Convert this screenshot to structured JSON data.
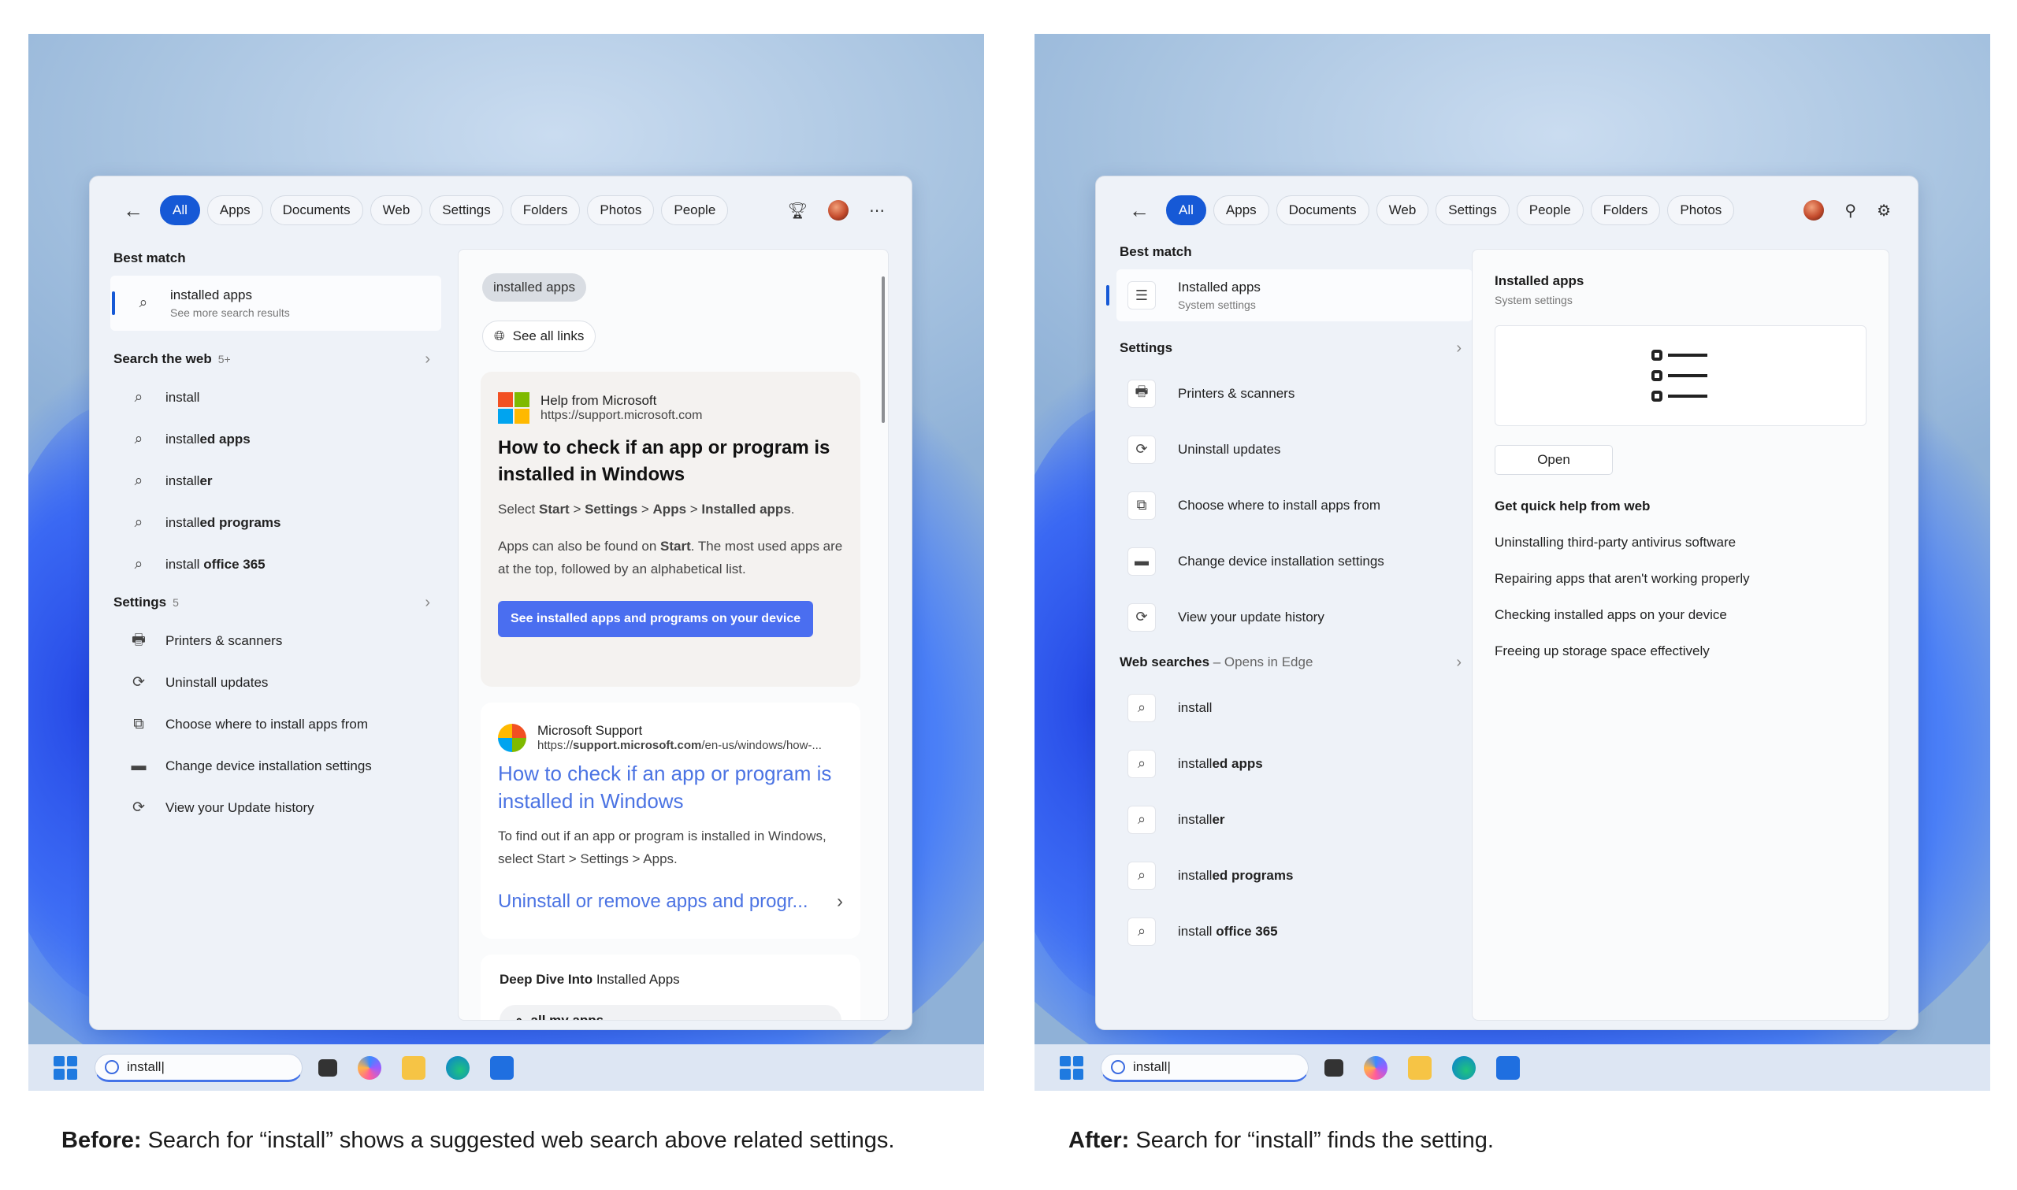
{
  "before": {
    "tabs": [
      "All",
      "Apps",
      "Documents",
      "Web",
      "Settings",
      "Folders",
      "Photos",
      "People"
    ],
    "best_match_label": "Best match",
    "best_match": {
      "title": "installed apps",
      "subtitle": "See more search results"
    },
    "web_section": {
      "label": "Search the web",
      "count": "5+"
    },
    "web_items": [
      {
        "pre": "install",
        "post": ""
      },
      {
        "pre": "install",
        "post": "ed apps"
      },
      {
        "pre": "install",
        "post": "er"
      },
      {
        "pre": "install",
        "post": "ed programs"
      },
      {
        "pre": "install ",
        "post": "office 365"
      }
    ],
    "settings_section": {
      "label": "Settings",
      "count": "5"
    },
    "settings_items": [
      {
        "icon": "printer-icon",
        "glyph": "🖶",
        "label": "Printers & scanners"
      },
      {
        "icon": "refresh-icon",
        "glyph": "⟳",
        "label": "Uninstall updates"
      },
      {
        "icon": "app-install-icon",
        "glyph": "⧉",
        "label": "Choose where to install apps from"
      },
      {
        "icon": "device-bar-icon",
        "glyph": "▬",
        "label": "Change device installation settings"
      },
      {
        "icon": "refresh-icon",
        "glyph": "⟳",
        "label": "View your Update history"
      }
    ],
    "preview": {
      "pill": "installed apps",
      "see_all": "See all links",
      "help_source": "Help from Microsoft",
      "help_url": "https://support.microsoft.com",
      "help_title": "How to check if an app or program is installed in Windows",
      "help_p1_pre": "Select ",
      "help_p1_b1": "Start",
      "help_p1_s1": " > ",
      "help_p1_b2": "Settings",
      "help_p1_s2": " > ",
      "help_p1_b3": "Apps",
      "help_p1_s3": " > ",
      "help_p1_b4": "Installed apps",
      "help_p1_end": ".",
      "help_p2_pre": "Apps can also be found on ",
      "help_p2_b": "Start",
      "help_p2_post": ". The most used apps are at the top, followed by an alphabetical list.",
      "help_button": "See installed apps and programs on your device",
      "support_source": "Microsoft Support",
      "support_url_pre": "https://",
      "support_url_b": "support.microsoft.com",
      "support_url_post": "/en-us/windows/how-...",
      "support_title": "How to check if an app or program is installed in Windows",
      "support_text": "To find out if an app or program is installed in Windows, select Start > Settings > Apps.",
      "support_link2": "Uninstall or remove apps and progr...",
      "deep_b": "Deep Dive Into",
      "deep_rest": " Installed Apps",
      "deep_item": "all my apps"
    },
    "taskbar_search": "install|",
    "caption_b": "Before:",
    "caption": " Search for “install” shows a suggested web search above related settings."
  },
  "after": {
    "tabs": [
      "All",
      "Apps",
      "Documents",
      "Web",
      "Settings",
      "People",
      "Folders",
      "Photos"
    ],
    "best_match_label": "Best match",
    "best_match": {
      "title": "Installed apps",
      "subtitle": "System settings"
    },
    "settings_section": {
      "label": "Settings"
    },
    "settings_items": [
      {
        "icon": "printer-icon",
        "glyph": "🖶",
        "label": "Printers & scanners"
      },
      {
        "icon": "refresh-icon",
        "glyph": "⟳",
        "label": "Uninstall updates"
      },
      {
        "icon": "app-install-icon",
        "glyph": "⧉",
        "label": "Choose where to install apps from"
      },
      {
        "icon": "device-bar-icon",
        "glyph": "▬",
        "label": "Change device installation settings"
      },
      {
        "icon": "refresh-icon",
        "glyph": "⟳",
        "label": "View your update history"
      }
    ],
    "web_section": {
      "label": "Web searches",
      "suffix": " – Opens in Edge"
    },
    "web_items": [
      {
        "pre": "install",
        "post": ""
      },
      {
        "pre": "install",
        "post": "ed apps"
      },
      {
        "pre": "install",
        "post": "er"
      },
      {
        "pre": "install",
        "post": "ed programs"
      },
      {
        "pre": "install ",
        "post": "office 365"
      }
    ],
    "detail": {
      "title": "Installed apps",
      "subtitle": "System settings",
      "open": "Open",
      "help_head": "Get quick help from web",
      "links": [
        "Uninstalling third-party antivirus software",
        "Repairing apps that aren't working properly",
        "Checking installed apps on your device",
        "Freeing up storage space effectively"
      ]
    },
    "taskbar_search": "install|",
    "caption_b": "After:",
    "caption": " Search for “install” finds the setting."
  },
  "colors": {
    "accent": "#1659d6",
    "link": "#4b73e3",
    "button": "#4a6ef0"
  }
}
